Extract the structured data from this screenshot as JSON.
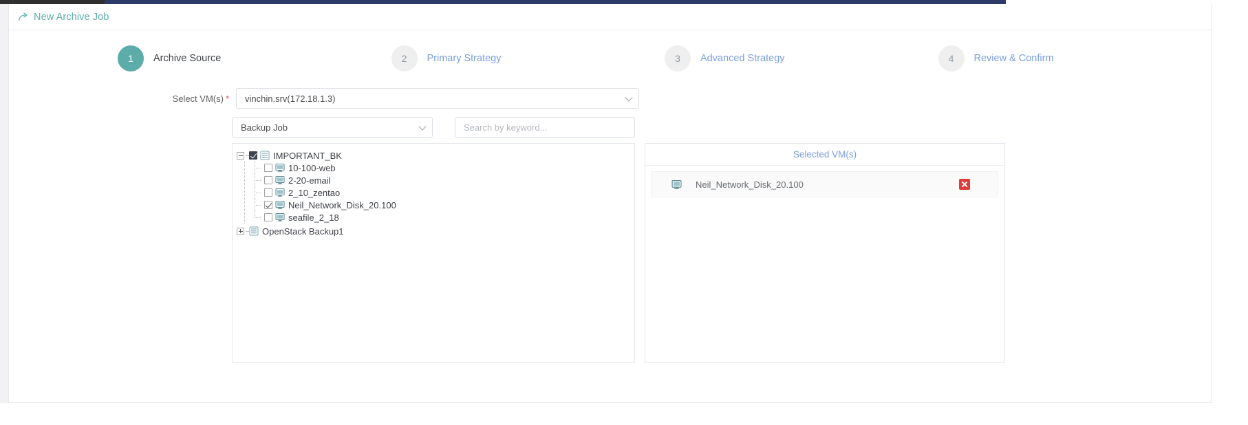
{
  "header": {
    "icon": "share-arrow-icon",
    "title": "New Archive Job"
  },
  "stepper": {
    "steps": [
      {
        "number": "1",
        "label": "Archive Source",
        "active": true
      },
      {
        "number": "2",
        "label": "Primary Strategy",
        "active": false
      },
      {
        "number": "3",
        "label": "Advanced Strategy",
        "active": false
      },
      {
        "number": "4",
        "label": "Review & Confirm",
        "active": false
      }
    ]
  },
  "form": {
    "select_vms_label": "Select VM(s)",
    "required_marker": "*",
    "host_select_value": "vinchin.srv(172.18.1.3)",
    "filter_select_value": "Backup Job",
    "search_placeholder": "Search by keyword..."
  },
  "tree": {
    "nodes": [
      {
        "label": "IMPORTANT_BK",
        "expander": "minus",
        "checkbox": "checked-filled",
        "icon": "list-icon",
        "children": [
          {
            "label": "10-100-web",
            "checkbox": "unchecked",
            "icon": "vm-icon"
          },
          {
            "label": "2-20-email",
            "checkbox": "unchecked",
            "icon": "vm-icon"
          },
          {
            "label": "2_10_zentao",
            "checkbox": "unchecked",
            "icon": "vm-icon"
          },
          {
            "label": "Neil_Network_Disk_20.100",
            "checkbox": "checked",
            "icon": "vm-icon"
          },
          {
            "label": "seafile_2_18",
            "checkbox": "unchecked",
            "icon": "vm-icon"
          }
        ]
      },
      {
        "label": "OpenStack Backup1",
        "expander": "plus",
        "checkbox": "none",
        "icon": "list-icon",
        "children": []
      }
    ]
  },
  "selected": {
    "title": "Selected VM(s)",
    "items": [
      {
        "name": "Neil_Network_Disk_20.100",
        "icon": "vm-icon",
        "remove_label": "remove"
      }
    ]
  },
  "colors": {
    "accent_teal": "#5cadaa",
    "link_blue": "#7a9fe0",
    "danger_red": "#e03c3c",
    "required_red": "#e4504d"
  }
}
